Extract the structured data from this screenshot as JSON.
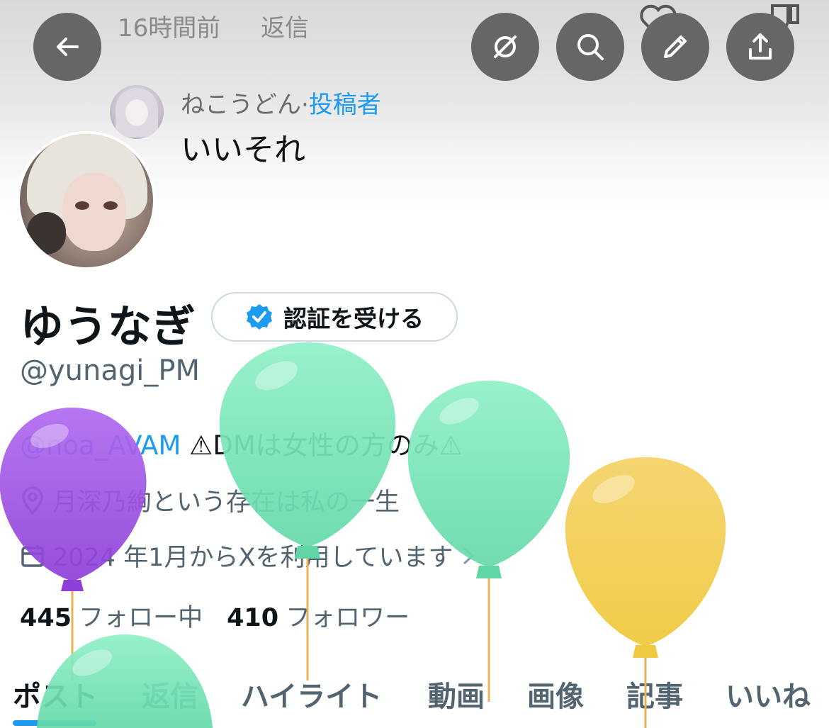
{
  "background": {
    "timestamp": "16時間前",
    "reply_link": "返信",
    "reply": {
      "author": "ねこうどん",
      "separator": "·",
      "role": "投稿者",
      "text": "いいそれ"
    }
  },
  "toolbar": {
    "back": "back-arrow-icon",
    "grok": "grok-icon",
    "search": "search-icon",
    "edit": "pencil-icon",
    "share": "share-icon"
  },
  "profile": {
    "display_name": "ゆうなぎ",
    "verify_button": "認証を受ける",
    "handle": "@yunagi_PM",
    "bio_mention": "@noa_AVAM",
    "bio_text": " ⚠DMは女性の方のみ⚠",
    "location": "月深乃絢という存在は私の一生",
    "joined": "2024 年1月からXを利用しています",
    "following_count": "445",
    "following_label": "フォロー中",
    "followers_count": "410",
    "followers_label": "フォロワー"
  },
  "tabs": [
    "ポスト",
    "返信",
    "ハイライト",
    "動画",
    "画像",
    "記事",
    "いいね"
  ],
  "colors": {
    "accent": "#1d9bf0",
    "balloon_purple": "#9b4de0",
    "balloon_mint": "#7ee3b8",
    "balloon_yellow": "#f2cd55"
  }
}
